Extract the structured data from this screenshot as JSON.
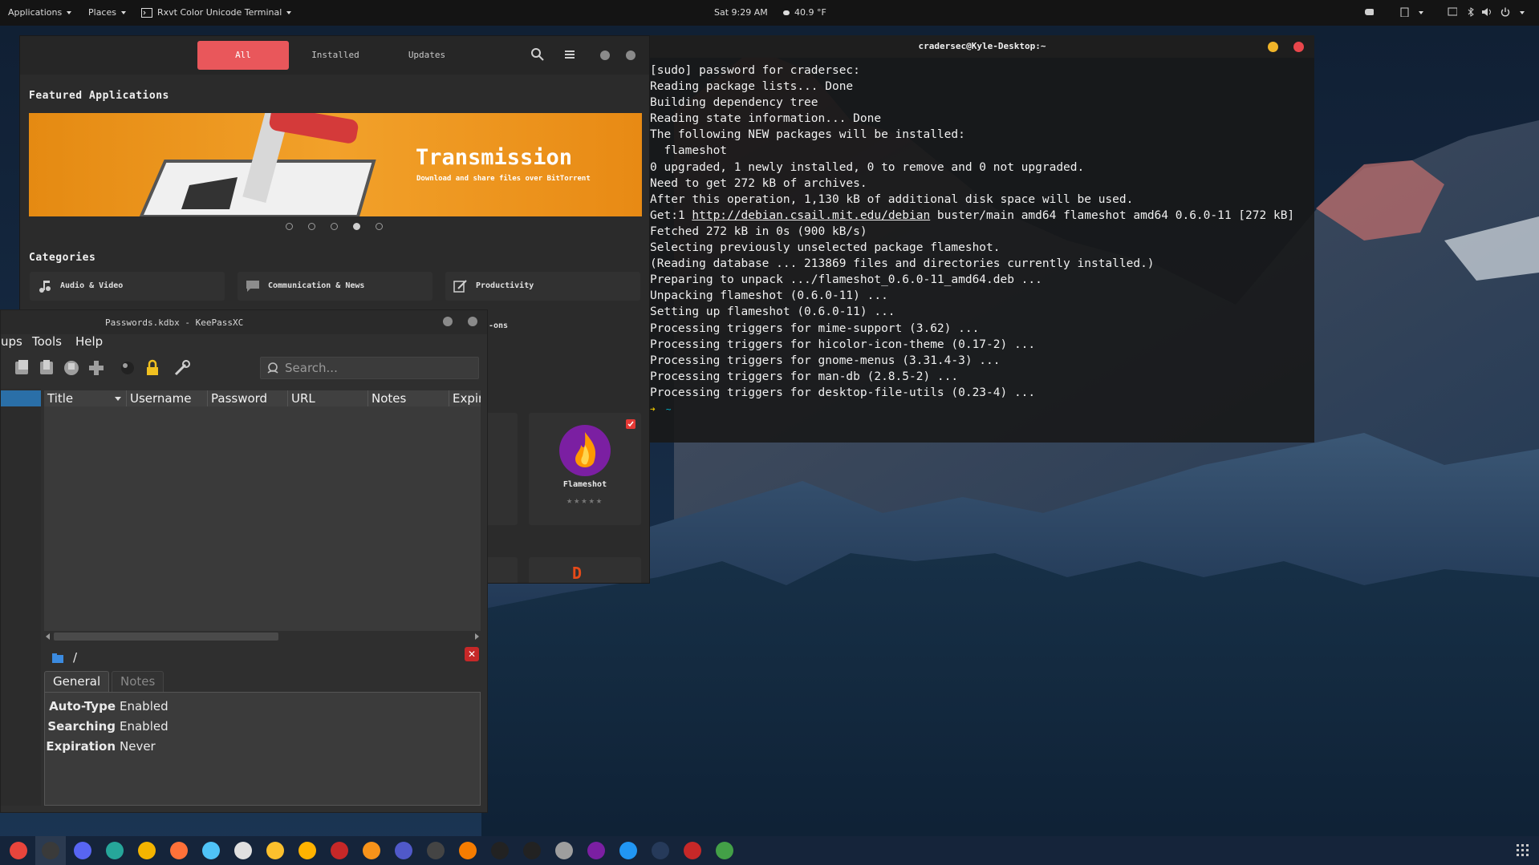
{
  "top_panel": {
    "applications": "Applications",
    "places": "Places",
    "active_app": "Rxvt Color Unicode Terminal",
    "clock": "Sat 9:29 AM",
    "weather": "40.9 °F"
  },
  "software_center": {
    "tabs": [
      {
        "label": "All",
        "active": true
      },
      {
        "label": "Installed",
        "active": false
      },
      {
        "label": "Updates",
        "active": false
      }
    ],
    "featured_title": "Featured Applications",
    "banner": {
      "title": "Transmission",
      "subtitle": "Download and share files over BitTorrent"
    },
    "carousel": {
      "count": 5,
      "active_index": 3
    },
    "categories_title": "Categories",
    "categories": [
      {
        "label": "Audio & Video",
        "icon": "music-note-icon"
      },
      {
        "label": "Communication & News",
        "icon": "chat-icon"
      },
      {
        "label": "Productivity",
        "icon": "edit-icon"
      }
    ],
    "partial_category": "-ons",
    "featured_app": {
      "name": "Flameshot",
      "rating_stars": 0,
      "max_stars": 5
    }
  },
  "keepass": {
    "title": "Passwords.kdbx - KeePassXC",
    "menu": [
      "ups",
      "Tools",
      "Help"
    ],
    "search_placeholder": "Search...",
    "columns": [
      "Title",
      "Username",
      "Password",
      "URL",
      "Notes",
      "Expire"
    ],
    "path": "/",
    "detail_tabs": [
      {
        "label": "General",
        "active": true
      },
      {
        "label": "Notes",
        "active": false
      }
    ],
    "details": [
      {
        "key": "Auto-Type",
        "value": "Enabled"
      },
      {
        "key": "Searching",
        "value": "Enabled"
      },
      {
        "key": "Expiration",
        "value": "Never"
      }
    ]
  },
  "terminal": {
    "title": "cradersec@Kyle-Desktop:~",
    "lines": [
      "[sudo] password for cradersec:",
      "Reading package lists... Done",
      "Building dependency tree",
      "Reading state information... Done",
      "The following NEW packages will be installed:",
      "  flameshot",
      "0 upgraded, 1 newly installed, 0 to remove and 0 not upgraded.",
      "Need to get 272 kB of archives.",
      "After this operation, 1,130 kB of additional disk space will be used."
    ],
    "get_line": {
      "prefix": "Get:1 ",
      "url": "http://debian.csail.mit.edu/debian",
      "suffix": " buster/main amd64 flameshot amd64 0.6.0-11 [272 kB]"
    },
    "lines2": [
      "Fetched 272 kB in 0s (900 kB/s)",
      "Selecting previously unselected package flameshot.",
      "(Reading database ... 213869 files and directories currently installed.)",
      "Preparing to unpack .../flameshot_0.6.0-11_amd64.deb ...",
      "Unpacking flameshot (0.6.0-11) ...",
      "Setting up flameshot (0.6.0-11) ...",
      "Processing triggers for mime-support (3.62) ...",
      "Processing triggers for hicolor-icon-theme (0.17-2) ...",
      "Processing triggers for gnome-menus (3.31.4-3) ...",
      "Processing triggers for man-db (2.8.5-2) ...",
      "Processing triggers for desktop-file-utils (0.23-4) ..."
    ],
    "prompt_arrow": "➜",
    "prompt_dir": "~"
  },
  "colors": {
    "accent": "#e9575b",
    "prompt_arrow": "#e5c100",
    "prompt_dir": "#00bcd4",
    "close_button": "#e8464b",
    "minimize_button": "#f0b429"
  },
  "dock": {
    "icons": [
      "chrome-icon",
      "terminal-icon",
      "discord-icon",
      "notes-icon",
      "files-icon",
      "firefox-icon",
      "web-browser-icon",
      "clock-icon",
      "media-player-icon",
      "archive-icon",
      "filezilla-icon",
      "bitcoin-icon",
      "teams-icon",
      "gimp-icon",
      "target-icon",
      "steam-icon",
      "inkscape-icon",
      "settings-icon",
      "tor-icon",
      "signal-icon",
      "app-icon",
      "info-icon",
      "keepass-icon"
    ],
    "active_index": 1,
    "grid_icon": "app-grid-icon"
  }
}
